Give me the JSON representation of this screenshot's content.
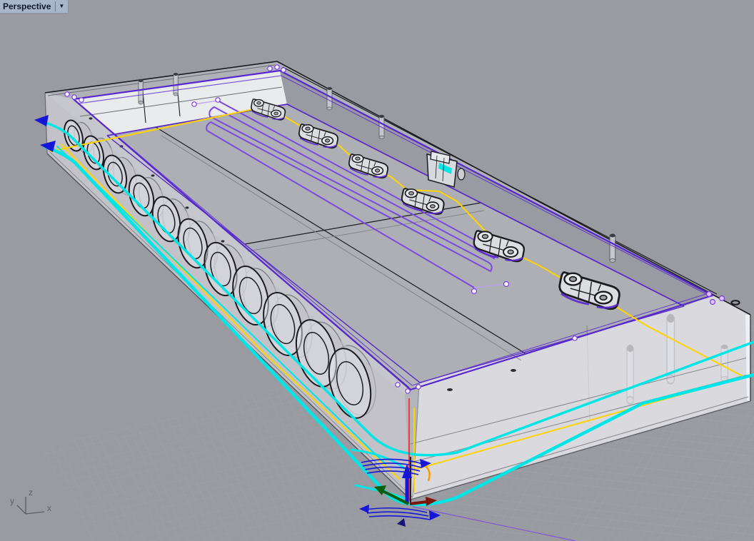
{
  "viewport": {
    "label": "Perspective",
    "menu_arrow": "▼"
  },
  "axis_gizmo": {
    "x": "x",
    "y": "y",
    "z": "z"
  },
  "colors": {
    "background": "#9a9ba1",
    "tab_bg": "#a9b6ca",
    "tab_border": "#8593a8",
    "tab_text": "#0e1430",
    "grid_minor": "#aeafb7",
    "grid_major": "#8e9098",
    "edge_dark": "#1b1b20",
    "edge_gray": "#6b6c74",
    "face_light": "#e9ebed",
    "face_floor": "#aeafb5",
    "face_wall_shadow": "#999aa2",
    "face_band": "#b0b1b7",
    "face_outer": "#c6c7cd",
    "face_translucent": "#e7e8ec",
    "sel_purple": "#5628cf",
    "sel_purple_light": "#7a4ae0",
    "sel_yellow": "#ffd400",
    "sel_cyan": "#00e5e6",
    "arrow_blue": "#1616d8",
    "arrow_green": "#0b5e0b",
    "arrow_red": "#7c150a",
    "axis_red": "#fb2018",
    "orange_accent": "#ff9800",
    "cp_fill": "#f6f2ff",
    "cp_stroke": "#7b3fe0",
    "gizmo_line": "#5d5e66"
  }
}
